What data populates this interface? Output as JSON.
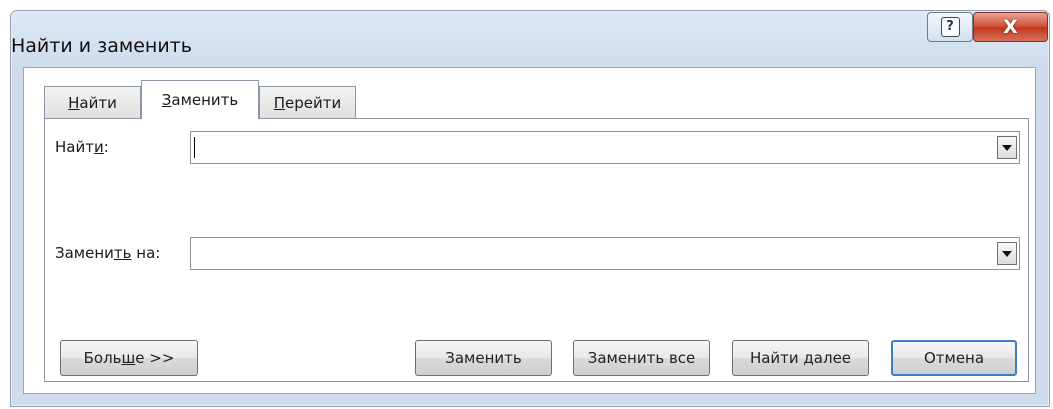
{
  "window": {
    "title": "Найти и заменить",
    "help_button": "?",
    "close_button": "X"
  },
  "tabs": [
    {
      "pre": "",
      "acc": "Н",
      "post": "айти",
      "active": false
    },
    {
      "pre": "",
      "acc": "З",
      "post": "аменить",
      "active": true
    },
    {
      "pre": "",
      "acc": "П",
      "post": "ерейти",
      "active": false
    }
  ],
  "find": {
    "label_pre": "Найт",
    "label_acc": "и",
    "label_post": ":",
    "value": ""
  },
  "replace": {
    "label_pre": "Замени",
    "label_acc": "т",
    "label_mid": "ь",
    "label_post": " на:",
    "value": ""
  },
  "buttons": {
    "more_pre": "Боль",
    "more_acc": "ш",
    "more_post": "е >>",
    "replace": "Заменить",
    "replace_all": "Заменить все",
    "find_next": "Найти далее",
    "cancel": "Отмена"
  }
}
